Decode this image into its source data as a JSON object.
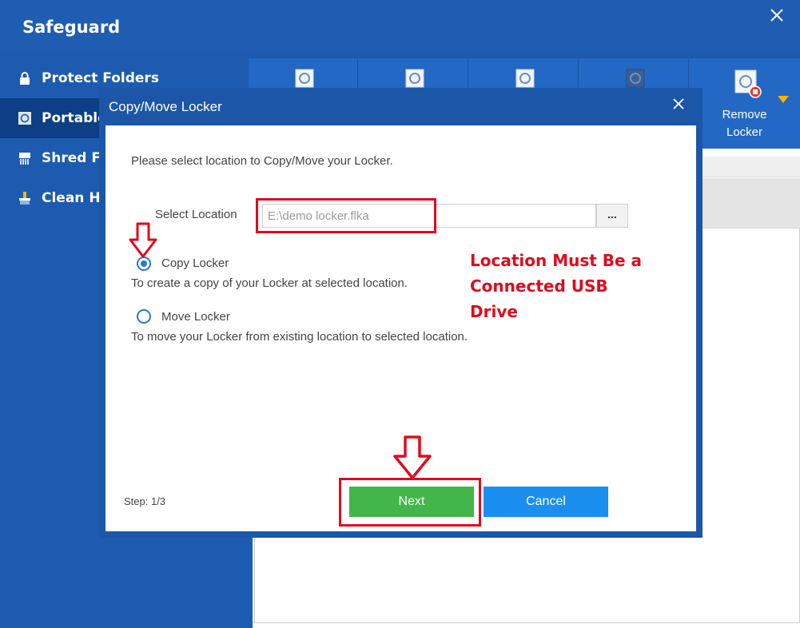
{
  "app": {
    "title": "Safeguard",
    "accent_color": "#1d5bb0"
  },
  "sidebar": {
    "items": [
      {
        "label": "Protect Folders",
        "icon": "lock-icon"
      },
      {
        "label": "Portable",
        "icon": "portable-locker-icon"
      },
      {
        "label": "Shred Fil",
        "icon": "shredder-icon"
      },
      {
        "label": "Clean His",
        "icon": "broom-icon"
      }
    ]
  },
  "toolbar": {
    "buttons": [
      {
        "icon": "locker-icon"
      },
      {
        "icon": "locker-icon"
      },
      {
        "icon": "locker-icon"
      },
      {
        "icon": "locker-icon"
      },
      {
        "label_line1": "Remove",
        "label_line2": "Locker",
        "icon": "remove-locker-icon"
      }
    ]
  },
  "dialog": {
    "title": "Copy/Move Locker",
    "intro": "Please select location to Copy/Move your Locker.",
    "location_label": "Select Location",
    "location_value": "E:\\demo locker.flka",
    "browse_label": "...",
    "options": [
      {
        "label": "Copy Locker",
        "description": "To create a copy of your Locker at selected location.",
        "checked": true
      },
      {
        "label": "Move Locker",
        "description": "To move your Locker from existing location to selected location.",
        "checked": false
      }
    ],
    "step": "Step: 1/3",
    "next_label": "Next",
    "cancel_label": "Cancel",
    "next_color": "#43b649",
    "cancel_color": "#1a8ff0"
  },
  "annotation": {
    "line1": "Location Must Be a",
    "line2": "Connected USB",
    "line3": "Drive",
    "color": "#e00b1c"
  }
}
